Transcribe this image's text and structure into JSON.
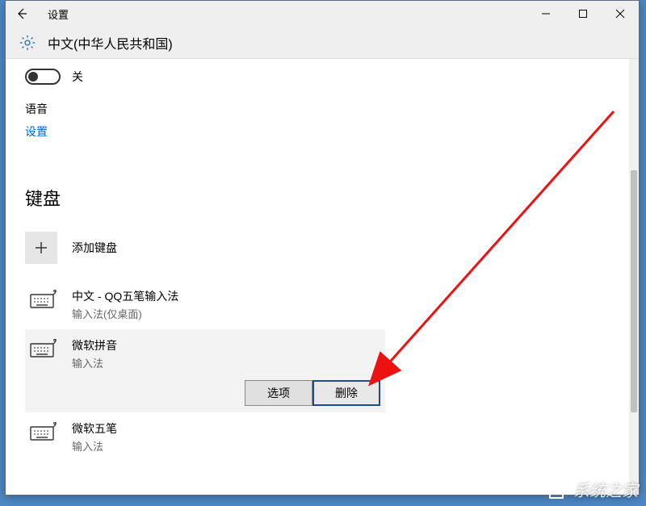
{
  "title": "设置",
  "language": "中文(中华人民共和国)",
  "toggle": {
    "state": "off",
    "label": "关"
  },
  "voice": {
    "label": "语音",
    "link": "设置"
  },
  "keyboards": {
    "title": "键盘",
    "add_label": "添加键盘",
    "items": [
      {
        "name": "中文 - QQ五笔输入法",
        "sub": "输入法(仅桌面)",
        "selected": false
      },
      {
        "name": "微软拼音",
        "sub": "输入法",
        "selected": true
      },
      {
        "name": "微软五笔",
        "sub": "输入法",
        "selected": false
      }
    ],
    "actions": {
      "options": "选项",
      "delete": "删除"
    }
  },
  "watermark": "系统之家"
}
